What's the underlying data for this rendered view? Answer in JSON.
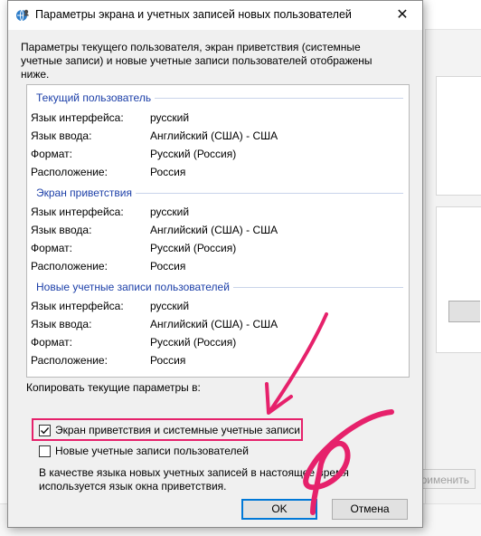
{
  "dialog": {
    "title": "Параметры экрана и учетных записей новых пользователей",
    "close_symbol": "✕",
    "intro": "Параметры текущего пользователя, экран приветствия (системные учетные записи) и новые учетные записи пользователей отображены ниже."
  },
  "labels": {
    "interface_language": "Язык интерфейса:",
    "input_language": "Язык ввода:",
    "format": "Формат:",
    "location": "Расположение:"
  },
  "sections": [
    {
      "title": "Текущий пользователь",
      "interface_language": "русский",
      "input_language": "Английский (США) - США",
      "format": "Русский (Россия)",
      "location": "Россия"
    },
    {
      "title": "Экран приветствия",
      "interface_language": "русский",
      "input_language": "Английский (США) - США",
      "format": "Русский (Россия)",
      "location": "Россия"
    },
    {
      "title": "Новые учетные записи пользователей",
      "interface_language": "русский",
      "input_language": "Английский (США) - США",
      "format": "Русский (Россия)",
      "location": "Россия"
    }
  ],
  "copy": {
    "label": "Копировать текущие параметры в:",
    "welcome_checkbox": {
      "label": "Экран приветствия и системные учетные записи",
      "checked": true
    },
    "new_users_checkbox": {
      "label": "Новые учетные записи пользователей",
      "checked": false
    },
    "note": "В качестве языка новых учетных записей в настоящее время используется язык окна приветствия."
  },
  "buttons": {
    "ok": "OK",
    "cancel": "Отмена"
  },
  "background_window": {
    "apply_button": "Применить"
  },
  "colors": {
    "section_title": "#1c3fa8",
    "annotation": "#e6216b",
    "ok_border": "#0078d7"
  },
  "icons": {
    "title": "globe-user-icon",
    "close": "close-icon",
    "checkbox_check": "checkmark-icon"
  }
}
